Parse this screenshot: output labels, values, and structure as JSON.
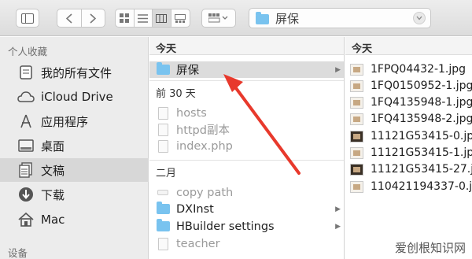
{
  "toolbar": {
    "path_title": "屏保"
  },
  "sidebar": {
    "favorites_header": "个人收藏",
    "devices_header": "设备",
    "items": [
      {
        "label": "我的所有文件",
        "icon": "all-files-icon"
      },
      {
        "label": "iCloud Drive",
        "icon": "cloud-icon"
      },
      {
        "label": "应用程序",
        "icon": "applications-icon"
      },
      {
        "label": "桌面",
        "icon": "desktop-icon"
      },
      {
        "label": "文稿",
        "icon": "documents-icon"
      },
      {
        "label": "下载",
        "icon": "downloads-icon"
      },
      {
        "label": "Mac",
        "icon": "home-icon"
      }
    ]
  },
  "column1": {
    "header": "今天",
    "today": [
      {
        "label": "屏保",
        "type": "folder"
      }
    ],
    "prev30_header": "前 30 天",
    "prev30": [
      {
        "label": "hosts",
        "type": "file"
      },
      {
        "label": "httpd副本",
        "type": "file"
      },
      {
        "label": "index.php",
        "type": "file"
      }
    ],
    "feb_header": "二月",
    "feb": [
      {
        "label": "copy path",
        "type": "alias"
      },
      {
        "label": "DXInst",
        "type": "folder"
      },
      {
        "label": "HBuilder settings",
        "type": "folder"
      },
      {
        "label": "teacher",
        "type": "file"
      }
    ]
  },
  "column2": {
    "header": "今天",
    "files": [
      "1FPQ04432-1.jpg",
      "1FQ0150952-1.jpg",
      "1FQ4135948-1.jpg",
      "1FQ4135948-2.jpg",
      "11121G53415-0.jpg",
      "11121G53415-1.jpg",
      "11121G53415-27.jpg",
      "110421194337-0.jpg"
    ]
  },
  "watermark": {
    "text": "爱创根知识网"
  },
  "colors": {
    "folder": "#79c3ef",
    "annotation_arrow": "#e8392c",
    "sidebar_bg": "#ececec",
    "selection": "#dcdcdc"
  }
}
